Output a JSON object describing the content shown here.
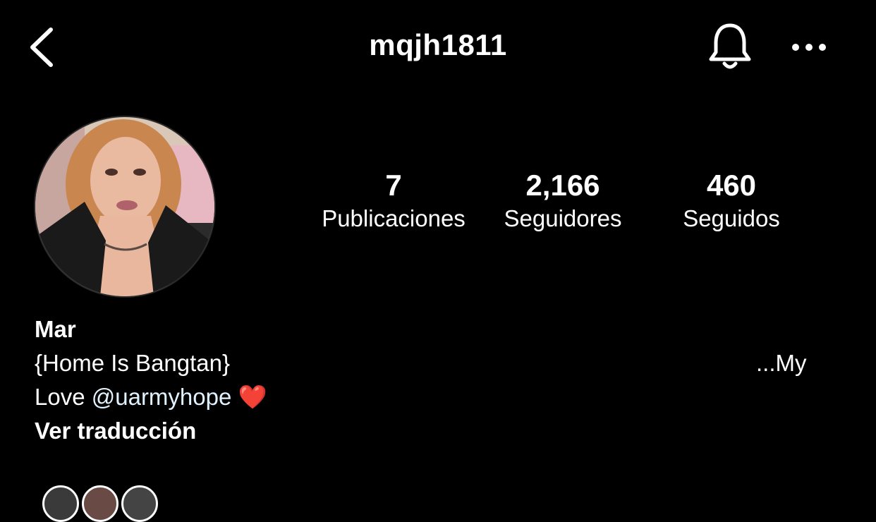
{
  "header": {
    "username": "mqjh1811",
    "back_icon": "chevron-left-icon",
    "bell_icon": "bell-icon",
    "more_icon": "more-horizontal-icon"
  },
  "stats": [
    {
      "value": "7",
      "label": "Publicaciones"
    },
    {
      "value": "2,166",
      "label": "Seguidores"
    },
    {
      "value": "460",
      "label": "Seguidos"
    }
  ],
  "profile": {
    "name": "Mar",
    "bio_line1_left": "{Home Is Bangtan}",
    "bio_line1_right": "...My",
    "bio_line2_text": "Love ",
    "bio_line2_mention": "@uarmyhope",
    "bio_line2_emoji": "❤️",
    "translate_label": "Ver traducción"
  },
  "colors": {
    "background": "#000000",
    "text": "#ffffff",
    "mention": "#e0f1ff"
  }
}
